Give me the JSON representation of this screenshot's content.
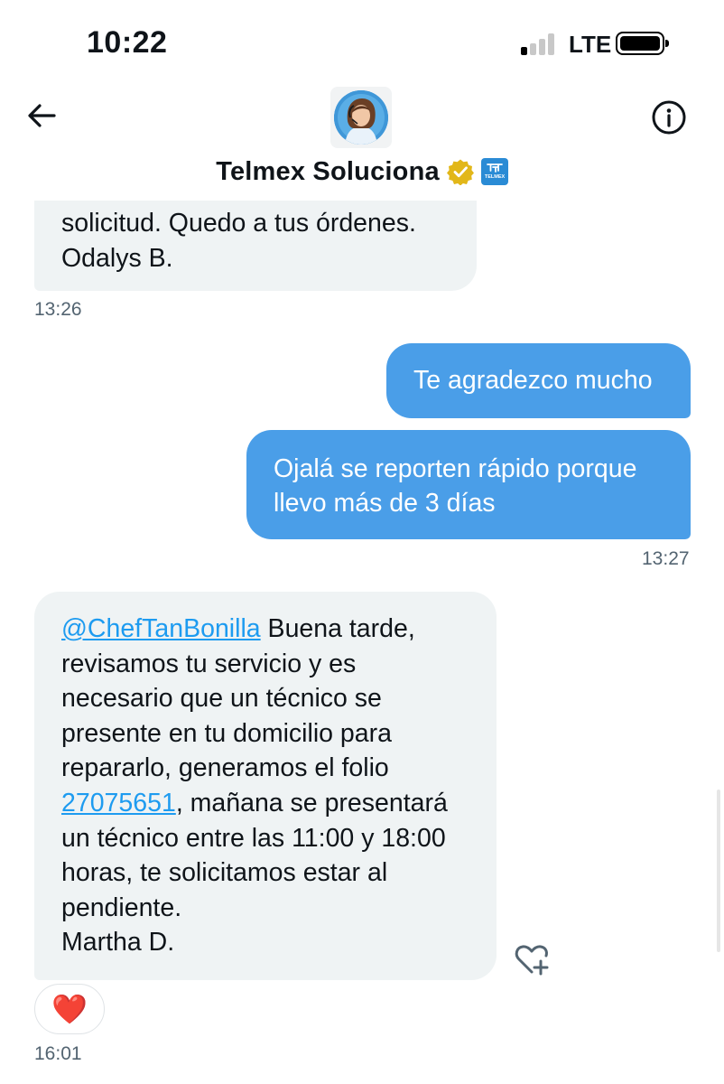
{
  "status_bar": {
    "time": "10:22",
    "network": "LTE",
    "signal_bars": 1
  },
  "header": {
    "title": "Telmex Soluciona",
    "icons": [
      "back-arrow-icon",
      "info-icon",
      "verified-gold-badge-icon",
      "telmex-affiliate-icon"
    ],
    "affiliate_text": "TELMEX"
  },
  "messages": [
    {
      "direction": "in",
      "lines": [
        "solicitud. Quedo a tus órdenes.",
        "Odalys B."
      ],
      "time": "13:26"
    },
    {
      "direction": "out",
      "text": "Te agradezco mucho"
    },
    {
      "direction": "out",
      "lines": [
        "Ojalá se reporten rápido porque",
        "llevo más de 3 días"
      ],
      "time": "13:27"
    },
    {
      "direction": "in",
      "mention": "@ChefTanBonilla",
      "line1_rest": " Buena tarde,",
      "line2": "revisamos tu servicio y es",
      "line3": "necesario que un técnico se",
      "line4": "presente en tu domicilio para",
      "line5": "repararlo, generamos el folio",
      "folio": "27075651",
      "line6_rest": ", mañana se presentará",
      "line7": "un técnico entre las 11:00 y 18:00",
      "line8": "horas, te solicitamos estar al",
      "line9": "pendiente.",
      "signature": "Martha D.",
      "reaction": "❤️",
      "time": "16:01"
    }
  ],
  "colors": {
    "outgoing_bubble": "#4a9ee8",
    "incoming_bubble": "#eff3f4",
    "link": "#1d9bf0",
    "verified": "#e2b719"
  }
}
